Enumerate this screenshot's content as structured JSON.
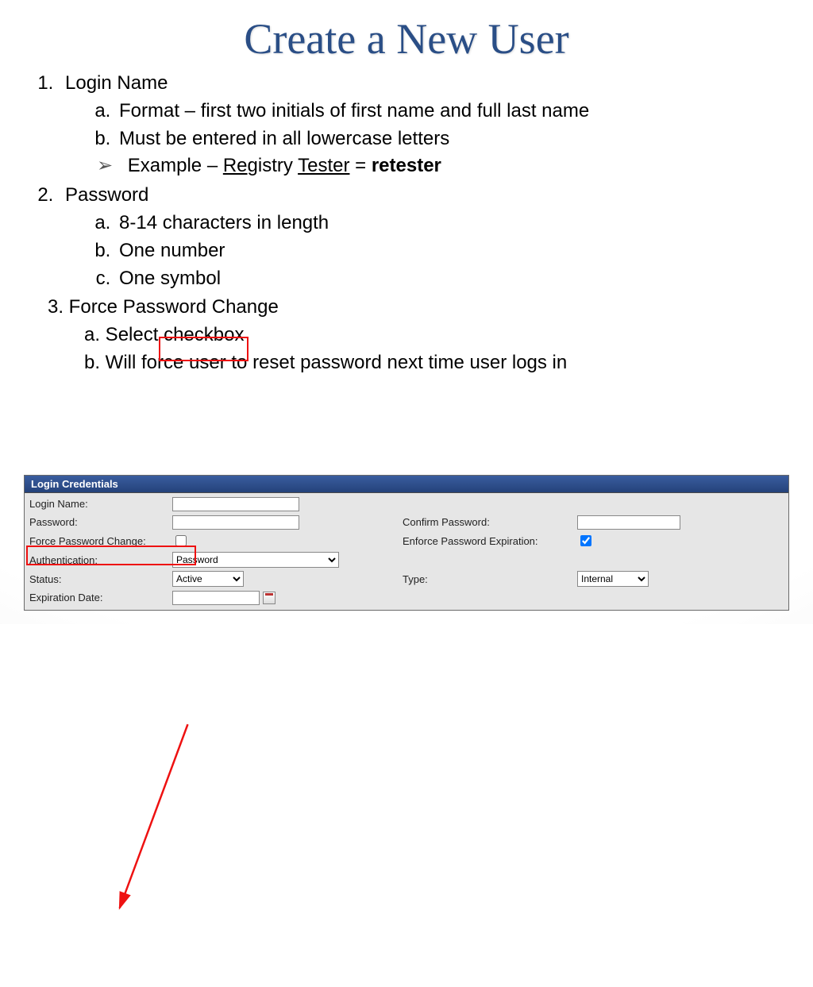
{
  "title": "Create a New User",
  "list": {
    "item1": "Login Name",
    "item1a": "Format – first two initials of first name and full last name",
    "item1b": "Must be entered in all lowercase letters",
    "item1ex_prefix": "Example – ",
    "item1ex_u1": "Re",
    "item1ex_mid1": "gistry ",
    "item1ex_u2": "Tester",
    "item1ex_mid2": " = ",
    "item1ex_bold": "retester",
    "item2": "Password",
    "item2a": "8-14 characters in length",
    "item2b": "One number",
    "item2c": "One symbol",
    "item3": "3. Force Password Change",
    "item3a_prefix": "a. Select ",
    "item3a_box": "checkbox",
    "item3b": "b. Will force user to reset password next time user logs in"
  },
  "panel": {
    "header": "Login Credentials",
    "login_label": "Login Name:",
    "password_label": "Password:",
    "confirm_label": "Confirm Password:",
    "force_label": "Force Password Change:",
    "enforce_label": "Enforce Password Expiration:",
    "auth_label": "Authentication:",
    "auth_value": "Password",
    "status_label": "Status:",
    "status_value": "Active",
    "type_label": "Type:",
    "type_value": "Internal",
    "exp_label": "Expiration Date:",
    "force_checked": false,
    "enforce_checked": true
  }
}
